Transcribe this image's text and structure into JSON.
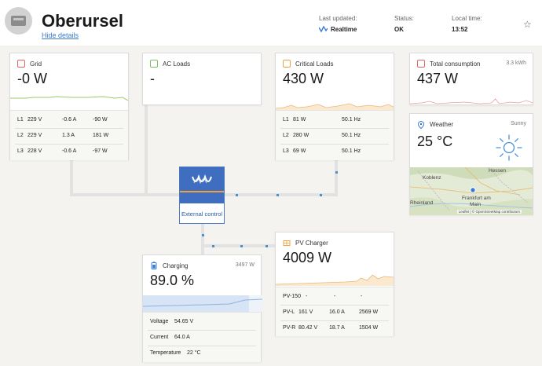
{
  "header": {
    "site_name": "Oberursel",
    "hide_details": "Hide details",
    "last_updated_label": "Last updated:",
    "last_updated_value": "Realtime",
    "status_label": "Status:",
    "status_value": "OK",
    "local_time_label": "Local time:",
    "local_time_value": "13:52",
    "favorite_icon": "star-outline"
  },
  "grid": {
    "title": "Grid",
    "value": "-0 W",
    "rows": [
      {
        "phase": "L1",
        "voltage": "229 V",
        "current": "-0.6 A",
        "power": "-90 W"
      },
      {
        "phase": "L2",
        "voltage": "229 V",
        "current": "1.3 A",
        "power": "181 W"
      },
      {
        "phase": "L3",
        "voltage": "228 V",
        "current": "-0.6 A",
        "power": "-97 W"
      }
    ]
  },
  "ac_loads": {
    "title": "AC Loads",
    "value": "-"
  },
  "critical_loads": {
    "title": "Critical Loads",
    "value": "430 W",
    "rows": [
      {
        "phase": "L1",
        "power": "81 W",
        "freq": "50.1 Hz"
      },
      {
        "phase": "L2",
        "power": "280 W",
        "freq": "50.1 Hz"
      },
      {
        "phase": "L3",
        "power": "69 W",
        "freq": "50.1 Hz"
      }
    ]
  },
  "total_consumption": {
    "title": "Total consumption",
    "energy": "3.3 kWh",
    "value": "437 W"
  },
  "weather": {
    "title": "Weather",
    "condition": "Sunny",
    "temperature": "25 °C",
    "map_labels": [
      "Hessen",
      "Koblenz",
      "Frankfurt am",
      "Main",
      "Rheinland"
    ],
    "attribution": "Leaflet | © OpenStreetMap contributors"
  },
  "controller": {
    "label": "External control"
  },
  "battery": {
    "title": "Charging",
    "power": "3497 W",
    "value": "89.0 %",
    "soc_fraction": 0.89,
    "rows": [
      {
        "label": "Voltage",
        "value": "54.65 V"
      },
      {
        "label": "Current",
        "value": "64.0 A"
      },
      {
        "label": "Temperature",
        "value": "22 °C"
      }
    ]
  },
  "pv_charger": {
    "title": "PV Charger",
    "value": "4009 W",
    "rows": [
      {
        "name": "PV-150",
        "voltage": "-",
        "current": "-",
        "power": "-"
      },
      {
        "name": "PV-L",
        "voltage": "161 V",
        "current": "16.0 A",
        "power": "2569 W"
      },
      {
        "name": "PV-R",
        "voltage": "80.42 V",
        "current": "18.7 A",
        "power": "1504 W"
      }
    ]
  },
  "colors": {
    "grid_accent": "#e06666",
    "grid_spark": "#9bc96a",
    "ac_accent": "#7bbf5a",
    "critical_accent": "#e8a14a",
    "consumption_accent": "#e06666",
    "weather_accent": "#3a7bd5",
    "battery_accent": "#3a7bd5",
    "pv_accent": "#f0a23a",
    "controller_blue": "#3f6ec1",
    "flow_blue": "#4a90c8"
  }
}
